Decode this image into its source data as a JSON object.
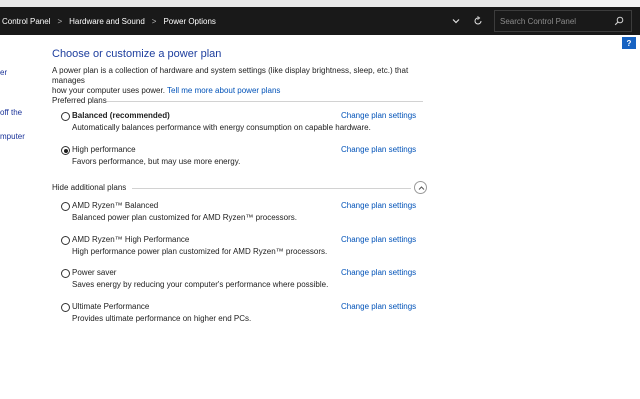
{
  "address_bar": {
    "breadcrumbs": [
      "Control Panel",
      "Hardware and Sound",
      "Power Options"
    ],
    "separator": ">",
    "search_placeholder": "Search Control Panel"
  },
  "help_label": "?",
  "left_nav": [
    "er",
    "off the",
    "mputer"
  ],
  "main": {
    "title": "Choose or customize a power plan",
    "intro_line1": "A power plan is a collection of hardware and system settings (like display brightness, sleep, etc.) that manages",
    "intro_line2": "how your computer uses power.",
    "intro_link": "Tell me more about power plans",
    "preferred_header": "Preferred plans",
    "additional_header": "Hide additional plans",
    "change_label": "Change plan settings",
    "preferred_plans": [
      {
        "name": "Balanced (recommended)",
        "description": "Automatically balances performance with energy consumption on capable hardware.",
        "selected": false
      },
      {
        "name": "High performance",
        "description": "Favors performance, but may use more energy.",
        "selected": true
      }
    ],
    "additional_plans": [
      {
        "name": "AMD Ryzen™ Balanced",
        "description": "Balanced power plan customized for AMD Ryzen™ processors.",
        "selected": false
      },
      {
        "name": "AMD Ryzen™ High Performance",
        "description": "High performance power plan customized for AMD Ryzen™ processors.",
        "selected": false
      },
      {
        "name": "Power saver",
        "description": "Saves energy by reducing your computer's performance where possible.",
        "selected": false
      },
      {
        "name": "Ultimate Performance",
        "description": "Provides ultimate performance on higher end PCs.",
        "selected": false
      }
    ]
  },
  "colors": {
    "address_bar_bg": "#191919",
    "title": "#1d3e9e",
    "link": "#0052b8",
    "help_button": "#1763c2"
  },
  "icons": {
    "dropdown": "chevron-down-icon",
    "refresh": "refresh-icon",
    "search": "search-icon",
    "collapse": "chevron-up-icon"
  }
}
